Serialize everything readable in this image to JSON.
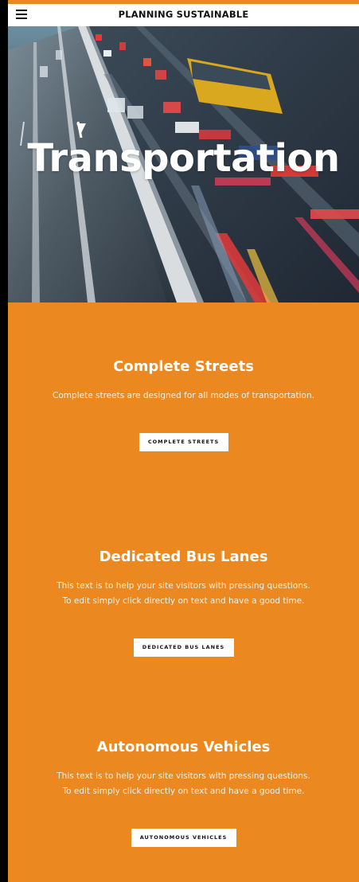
{
  "header": {
    "site_title": "PLANNING SUSTAINABLE",
    "menu_icon": "hamburger-menu-icon"
  },
  "hero": {
    "title": "Transportation",
    "image": "blurred highway traffic photo"
  },
  "sections": [
    {
      "heading": "Complete Streets",
      "lines": [
        "Complete streets are designed for all modes of transportation."
      ],
      "button_label": "COMPLETE STREETS"
    },
    {
      "heading": "Dedicated Bus Lanes",
      "lines": [
        "This text is to help your site visitors with pressing questions.",
        "To edit simply click directly on text and have a good time."
      ],
      "button_label": "DEDICATED BUS LANES"
    },
    {
      "heading": "Autonomous Vehicles",
      "lines": [
        "This text is to help your site visitors with pressing questions.",
        "To edit simply click directly on text and have a good time."
      ],
      "button_label": "AUTONOMOUS VEHICLES"
    }
  ],
  "colors": {
    "accent": "#ec8820",
    "header_bg": "#ffffff",
    "button_bg": "#ffffff",
    "text_on_accent": "#ffffff"
  }
}
